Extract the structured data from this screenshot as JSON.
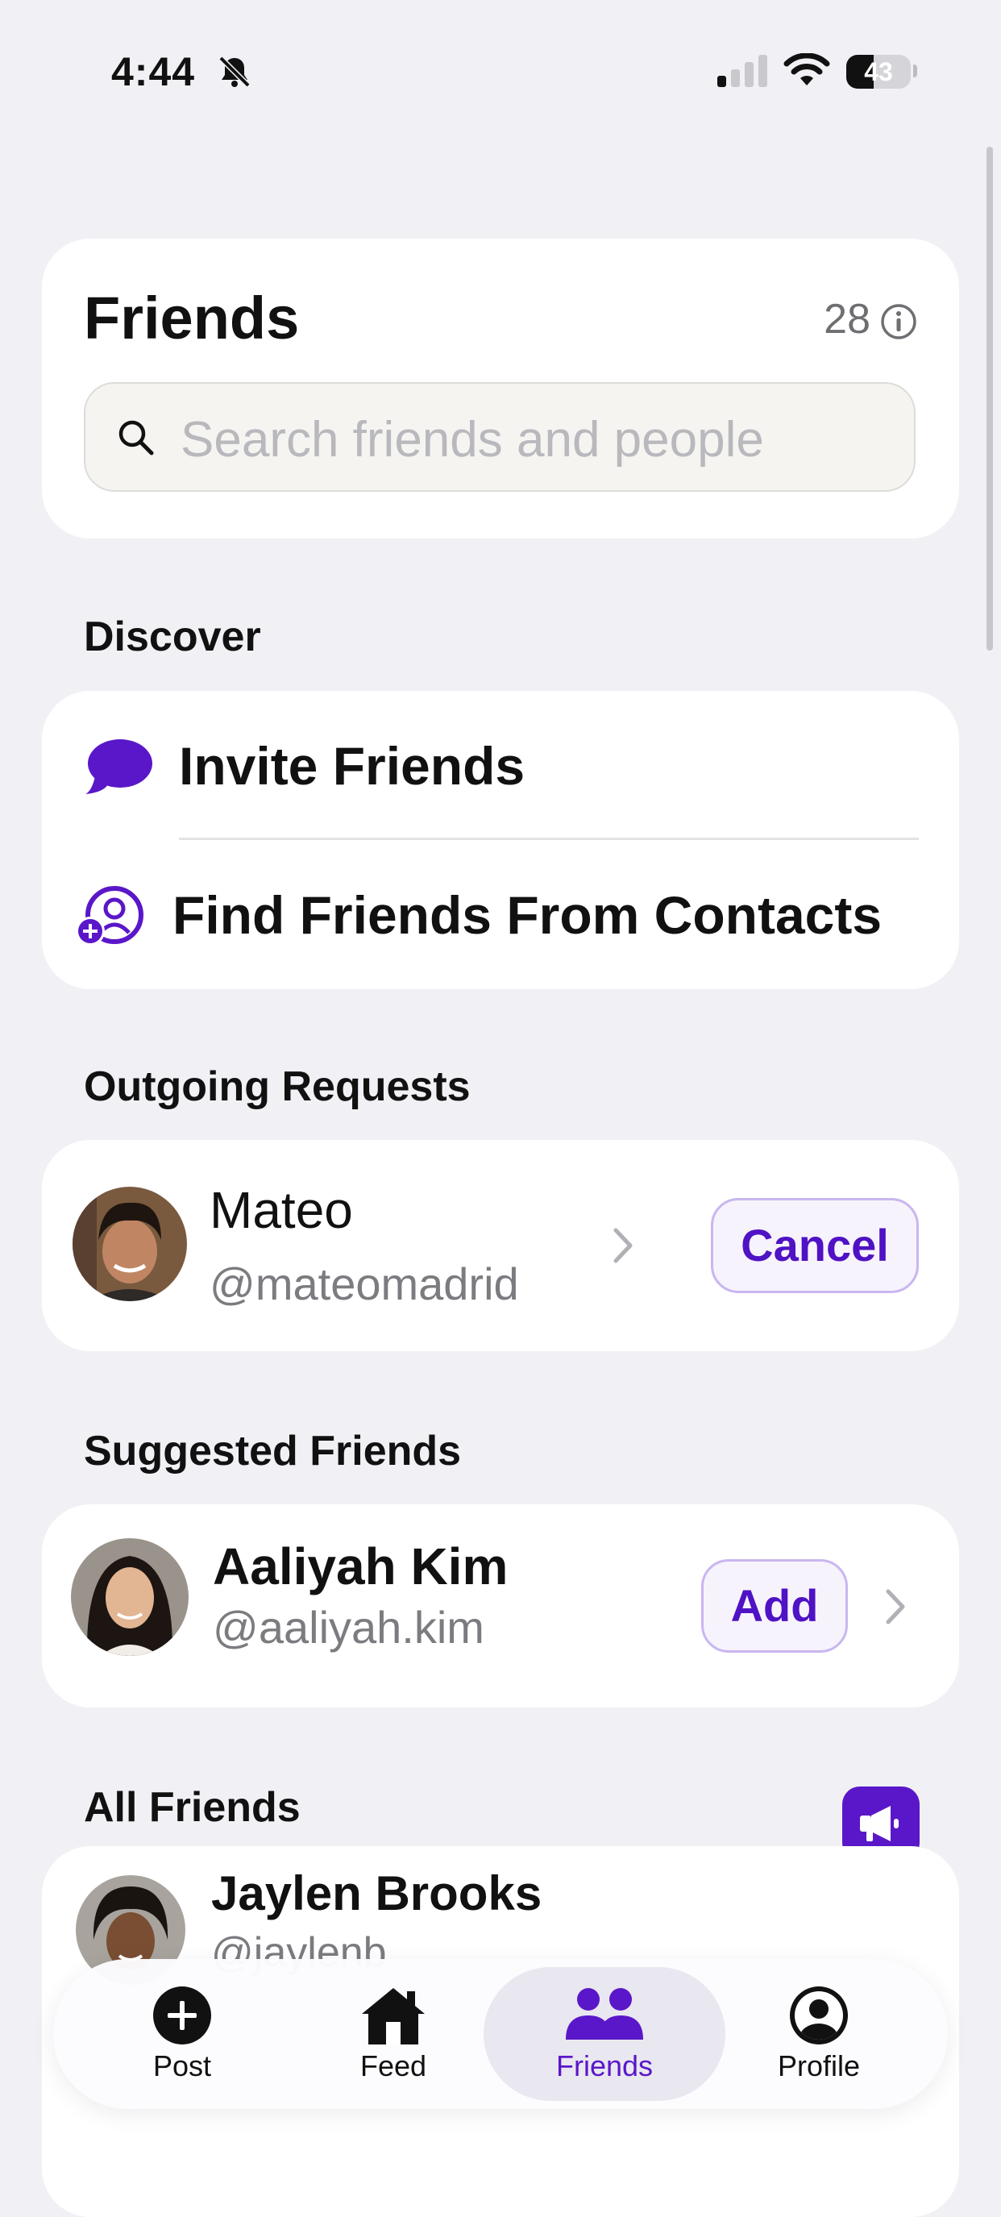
{
  "status_bar": {
    "time": "4:44",
    "battery": "43",
    "battery_level": 0.43
  },
  "header": {
    "title": "Friends",
    "count": "28",
    "search_placeholder": "Search friends and people"
  },
  "discover": {
    "label": "Discover",
    "items": [
      {
        "label": "Invite Friends",
        "icon": "chat-bubble-icon"
      },
      {
        "label": "Find Friends From Contacts",
        "icon": "add-contact-icon"
      }
    ]
  },
  "outgoing": {
    "label": "Outgoing Requests",
    "items": [
      {
        "name": "Mateo",
        "handle": "@mateomadrid",
        "action": "Cancel"
      }
    ]
  },
  "suggested": {
    "label": "Suggested Friends",
    "items": [
      {
        "name": "Aaliyah Kim",
        "handle": "@aaliyah.kim",
        "action": "Add"
      }
    ]
  },
  "all_friends": {
    "label": "All Friends",
    "items": [
      {
        "name": "Jaylen Brooks",
        "handle": "@jaylenb"
      }
    ]
  },
  "tabbar": {
    "items": [
      {
        "label": "Post",
        "icon": "plus-circle-icon"
      },
      {
        "label": "Feed",
        "icon": "home-icon"
      },
      {
        "label": "Friends",
        "icon": "people-icon",
        "active": true
      },
      {
        "label": "Profile",
        "icon": "person-circle-icon"
      }
    ]
  },
  "colors": {
    "accent": "#5a17c9",
    "background": "#f1f1f5",
    "card": "#ffffff"
  }
}
